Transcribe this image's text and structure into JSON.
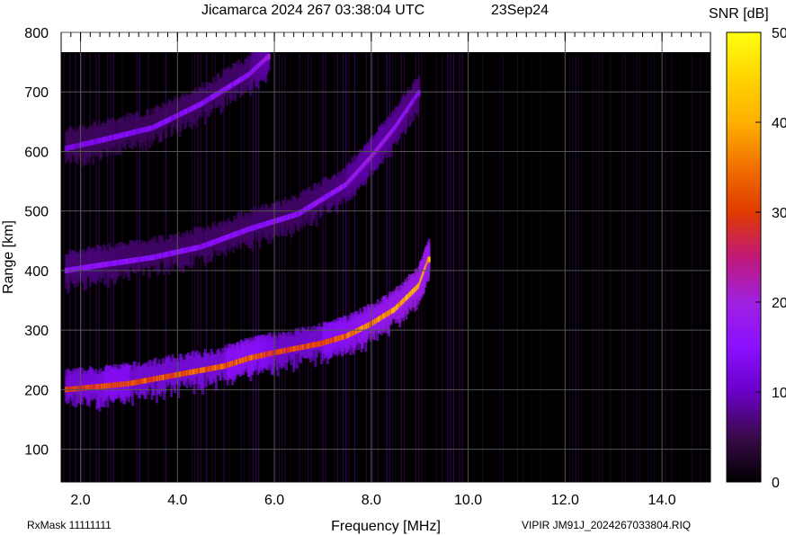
{
  "header": {
    "title": "Jicamarca 2024 267 03:38:04 UTC",
    "date": "23Sep24"
  },
  "footer": {
    "rxmask": "RxMask 11111111",
    "filename": "VIPIR  JM91J_2024267033804.RIQ"
  },
  "chart_data": {
    "type": "heatmap",
    "title": "Jicamarca 2024 267 03:38:04 UTC",
    "xlabel": "Frequency [MHz]",
    "ylabel": "Range [km]",
    "xlim": [
      1.6,
      15.0
    ],
    "ylim": [
      45,
      800
    ],
    "xticks": [
      2.0,
      4.0,
      6.0,
      8.0,
      10.0,
      12.0,
      14.0
    ],
    "xtick_labels": [
      "2.0",
      "4.0",
      "6.0",
      "8.0",
      "10.0",
      "12.0",
      "14.0"
    ],
    "yticks": [
      100,
      200,
      300,
      400,
      500,
      600,
      700,
      800
    ],
    "ytick_labels": [
      "100",
      "200",
      "300",
      "400",
      "500",
      "600",
      "700",
      "800"
    ],
    "grid": true,
    "data_top_km": 765,
    "colorbar": {
      "label": "SNR [dB]",
      "min": 0,
      "max": 50,
      "ticks": [
        0,
        10,
        20,
        30,
        40,
        50
      ],
      "tick_labels": [
        "0",
        "10",
        "20",
        "30",
        "40",
        "50"
      ],
      "colormap": [
        "#000000",
        "#3a0a4a",
        "#6a00c8",
        "#8a10ff",
        "#a020e0",
        "#c01878",
        "#e03a00",
        "#f07000",
        "#ffb000",
        "#ffd400",
        "#ffff10"
      ]
    },
    "traces": [
      {
        "name": "",
        "points": [
          [
            1.7,
            200
          ],
          [
            2.5,
            206
          ],
          [
            3.0,
            210
          ],
          [
            4.0,
            225
          ],
          [
            5.0,
            240
          ],
          [
            5.5,
            253
          ],
          [
            6.0,
            262
          ],
          [
            7.0,
            278
          ],
          [
            7.5,
            290
          ],
          [
            8.0,
            310
          ],
          [
            8.5,
            335
          ],
          [
            9.0,
            375
          ],
          [
            9.2,
            420
          ]
        ],
        "snr": [
          30,
          32,
          32,
          33,
          34,
          35,
          30,
          32,
          35,
          38,
          40,
          42,
          40
        ]
      },
      {
        "name": "",
        "points": [
          [
            1.7,
            400
          ],
          [
            2.5,
            410
          ],
          [
            3.5,
            422
          ],
          [
            4.5,
            440
          ],
          [
            5.5,
            470
          ],
          [
            6.5,
            495
          ],
          [
            7.5,
            545
          ],
          [
            8.0,
            590
          ],
          [
            8.5,
            640
          ],
          [
            9.0,
            700
          ]
        ],
        "snr": [
          16,
          16,
          15,
          15,
          15,
          15,
          18,
          20,
          18,
          15
        ]
      },
      {
        "name": "",
        "points": [
          [
            1.7,
            605
          ],
          [
            2.5,
            620
          ],
          [
            3.5,
            640
          ],
          [
            4.5,
            680
          ],
          [
            5.5,
            730
          ],
          [
            5.9,
            760
          ]
        ],
        "snr": [
          12,
          14,
          14,
          15,
          16,
          20
        ]
      }
    ]
  }
}
